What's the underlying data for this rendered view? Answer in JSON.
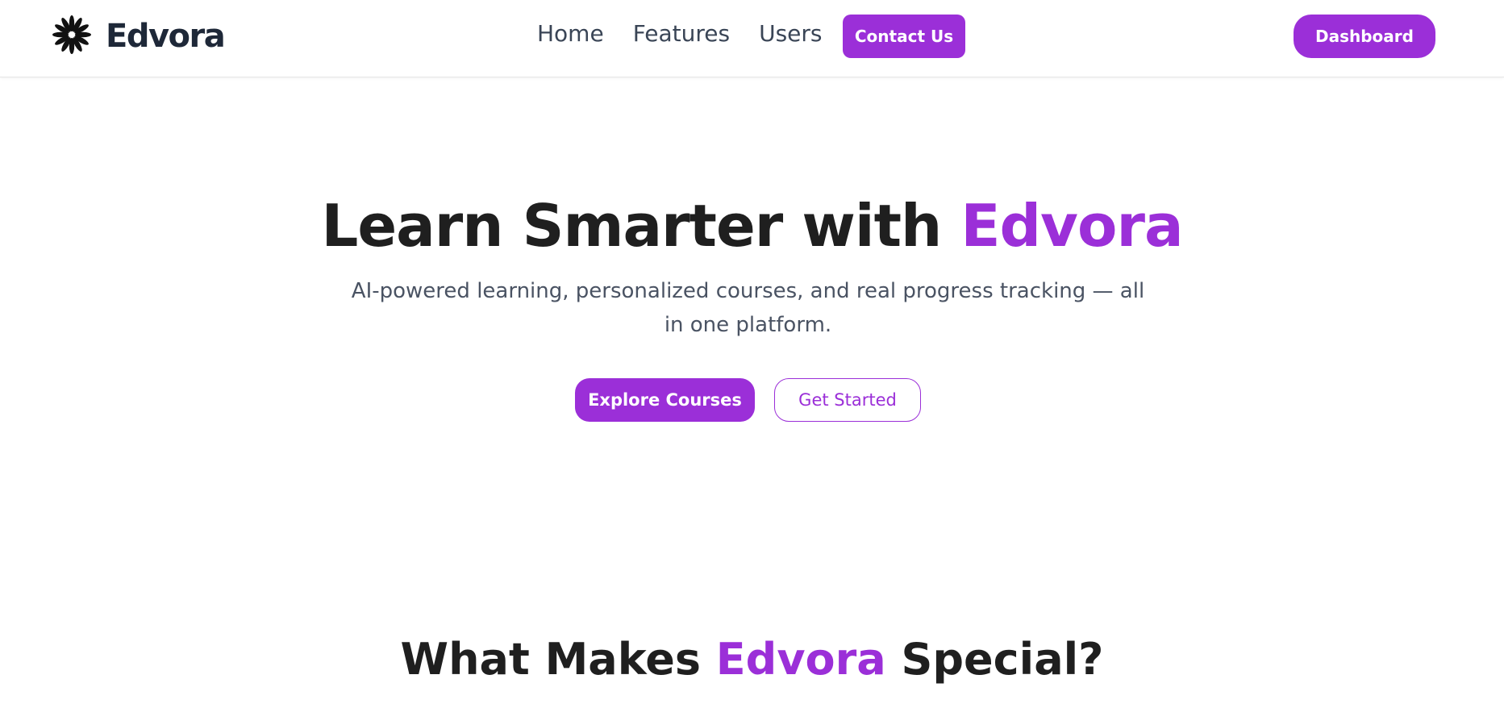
{
  "brand": {
    "name": "Edvora",
    "icon": "starburst-logo-icon",
    "accent_color": "#9b2fd8"
  },
  "nav": {
    "links": [
      "Home",
      "Features",
      "Users"
    ],
    "contact_label": "Contact Us",
    "dashboard_label": "Dashboard"
  },
  "hero": {
    "title_prefix": "Learn Smarter with ",
    "title_accent": "Edvora",
    "subtitle": "AI-powered learning, personalized courses, and real progress tracking — all in one platform.",
    "primary_cta": "Explore Courses",
    "secondary_cta": "Get Started"
  },
  "features_section": {
    "title_prefix": "What Makes ",
    "title_accent": "Edvora",
    "title_suffix": " Special?"
  }
}
